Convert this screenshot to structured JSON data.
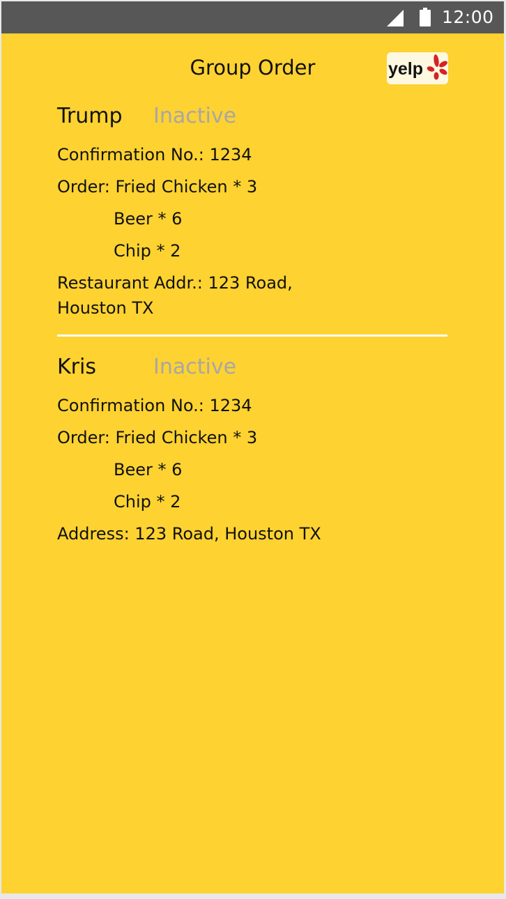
{
  "status_bar": {
    "time": "12:00",
    "icons": [
      "signal-icon",
      "battery-icon"
    ]
  },
  "header": {
    "title": "Group Order",
    "logo_text": "yelp"
  },
  "orders": [
    {
      "name": "Trump",
      "status": "Inactive",
      "confirmation": "Confirmation No.: 1234",
      "order_first": "Order: Fried Chicken * 3",
      "order_more": [
        "Beer * 6",
        "Chip * 2"
      ],
      "address_line1": "Restaurant Addr.: 123 Road,",
      "address_line2": "Houston TX"
    },
    {
      "name": "Kris",
      "status": "Inactive",
      "confirmation": "Confirmation No.: 1234",
      "order_first": "Order: Fried Chicken * 3",
      "order_more": [
        "Beer * 6",
        "Chip * 2"
      ],
      "address_line1": "Address: 123 Road, Houston TX"
    }
  ],
  "colors": {
    "background": "#fdd231",
    "status_bar": "#575757",
    "inactive_text": "#a8a6a8",
    "yelp_red": "#d32323"
  }
}
